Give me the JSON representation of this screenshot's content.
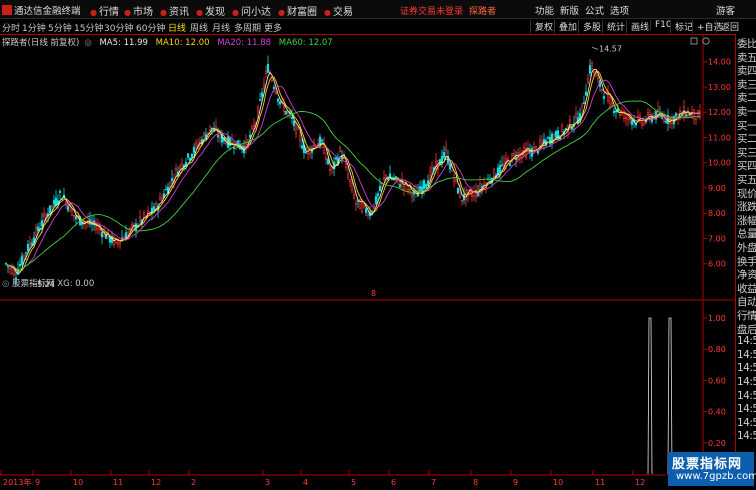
{
  "titlebar": {
    "app_name": "通达信金融终端",
    "menus": [
      "行情",
      "市场",
      "资讯",
      "发现",
      "问小达",
      "财富圈",
      "交易"
    ],
    "notice": "证券交易未登录",
    "user": "探路者",
    "right_items": [
      "功能",
      "新版",
      "公式",
      "选项",
      "游客"
    ]
  },
  "toolbar": {
    "periods": [
      "分时",
      "1分钟",
      "5分钟",
      "15分钟",
      "30分钟",
      "60分钟",
      "日线",
      "周线",
      "月线",
      "多周期",
      "更多"
    ],
    "active_period": "日线",
    "right_buttons": [
      "复权",
      "叠加",
      "多股",
      "统计",
      "画线",
      "F10",
      "标记",
      "+自选",
      "返回"
    ]
  },
  "chart_info": {
    "title": "探路者(日线 前复权)",
    "ma5": "MA5: 11.99",
    "ma10": "MA10: 12.00",
    "ma20": "MA20: 11.88",
    "ma60": "MA60: 12.07",
    "high_label": "14.57",
    "low_label": "5.24",
    "marker": "8"
  },
  "indicator": {
    "label": "股票指标网 XG: 0.00",
    "yticks": [
      "1.00",
      "0.80",
      "0.60",
      "0.40",
      "0.20"
    ]
  },
  "right_panel": {
    "items": [
      "委比",
      "卖五",
      "卖四",
      "卖三",
      "卖二",
      "卖一",
      "买一",
      "买二",
      "买三",
      "买四",
      "买五",
      "现价",
      "涨跌",
      "涨幅",
      "总量",
      "外盘",
      "换手",
      "净资",
      "收益",
      "自动",
      "行情",
      "盘后",
      "14:5(",
      "14:5(",
      "14:5(",
      "14:5(",
      "14:5(",
      "14:5(",
      "14:5(",
      "14:5("
    ]
  },
  "watermark": {
    "title": "股票指标网",
    "url": "www.7gpzb.com"
  },
  "chart_data": {
    "type": "candlestick",
    "price_ticks": [
      14.0,
      13.0,
      12.0,
      11.0,
      10.0,
      9.0,
      8.0,
      7.0,
      6.0
    ],
    "price_tick_labels": [
      "14.00",
      "13.00",
      "12.00",
      "11.00",
      "10.00",
      "9.00",
      "8.00",
      "7.00",
      "6.00"
    ],
    "ylim": [
      5.0,
      14.9
    ],
    "month_labels": [
      "2013年",
      "9",
      "10",
      "11",
      "12",
      "2",
      "3",
      "4",
      "5",
      "6",
      "7",
      "8",
      "9",
      "10",
      "11",
      "12"
    ],
    "high": 14.57,
    "low": 5.24,
    "key_closes": [
      [
        0,
        6.0
      ],
      [
        10,
        5.6
      ],
      [
        20,
        6.5
      ],
      [
        40,
        7.9
      ],
      [
        55,
        8.8
      ],
      [
        70,
        7.8
      ],
      [
        90,
        7.5
      ],
      [
        110,
        6.8
      ],
      [
        130,
        7.5
      ],
      [
        150,
        8.2
      ],
      [
        170,
        9.6
      ],
      [
        190,
        10.6
      ],
      [
        205,
        11.4
      ],
      [
        215,
        11.0
      ],
      [
        225,
        10.8
      ],
      [
        240,
        10.6
      ],
      [
        250,
        11.6
      ],
      [
        262,
        13.8
      ],
      [
        275,
        12.3
      ],
      [
        285,
        11.8
      ],
      [
        300,
        10.4
      ],
      [
        315,
        10.9
      ],
      [
        325,
        9.6
      ],
      [
        335,
        10.5
      ],
      [
        350,
        8.4
      ],
      [
        365,
        8.0
      ],
      [
        380,
        9.5
      ],
      [
        395,
        9.2
      ],
      [
        410,
        8.7
      ],
      [
        425,
        9.5
      ],
      [
        440,
        10.4
      ],
      [
        455,
        8.6
      ],
      [
        470,
        8.8
      ],
      [
        490,
        9.6
      ],
      [
        510,
        10.3
      ],
      [
        530,
        10.5
      ],
      [
        545,
        11.0
      ],
      [
        560,
        11.3
      ],
      [
        575,
        11.9
      ],
      [
        585,
        13.9
      ],
      [
        595,
        13.0
      ],
      [
        605,
        12.3
      ],
      [
        620,
        11.8
      ],
      [
        635,
        11.6
      ],
      [
        650,
        11.9
      ],
      [
        665,
        11.7
      ],
      [
        680,
        12.0
      ],
      [
        695,
        11.8
      ],
      [
        700,
        12.1
      ]
    ],
    "ma_periods": [
      5,
      10,
      20,
      60
    ],
    "indicator_spikes_x": [
      650,
      670
    ],
    "indicator_value": 1.0
  }
}
